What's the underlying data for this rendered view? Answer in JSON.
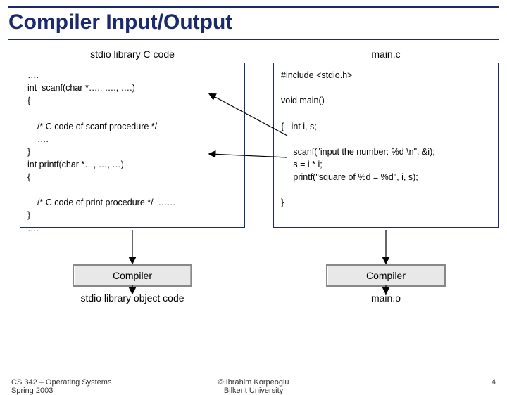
{
  "title": "Compiler Input/Output",
  "left": {
    "label": "stdio library C code",
    "code": "….\nint  scanf(char *…., …., ….)\n{\n\n    /* C code of scanf procedure */\n    ….\n}\nint printf(char *…, …, …)\n{\n\n    /* C code of print procedure */  ……\n}\n….",
    "compiler": "Compiler",
    "output": "stdio library object code"
  },
  "right": {
    "label": "main.c",
    "code": "#include <stdio.h>\n\nvoid main()\n\n{   int i, s;\n\n     scanf(\"input the number: %d \\n\", &i);\n     s = i * i;\n     printf(\"square of %d = %d\", i, s);\n\n}",
    "compiler": "Compiler",
    "output": "main.o"
  },
  "footer": {
    "left_line1": "CS 342 – Operating Systems",
    "left_line2": "Spring 2003",
    "center_line1": "© Ibrahim Korpeoglu",
    "center_line2": "Bilkent University",
    "page": "4"
  }
}
